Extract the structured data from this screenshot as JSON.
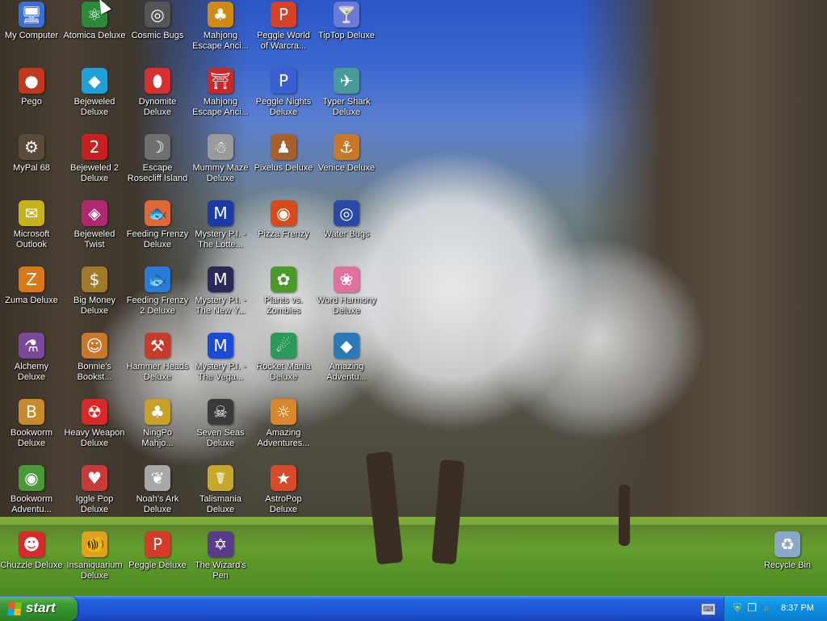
{
  "desktop": {
    "icons": [
      {
        "label": "My Computer",
        "icon": "computer-icon",
        "symbol": "🖥",
        "color": "#3b6fd6"
      },
      {
        "label": "Atomica Deluxe",
        "icon": "atomica-icon",
        "symbol": "⚛",
        "color": "#2a8a3a"
      },
      {
        "label": "Cosmic Bugs",
        "icon": "cosmic-bugs-icon",
        "symbol": "◎",
        "color": "#555555"
      },
      {
        "label": "Mahjong\nEscape Anci...",
        "icon": "mahjong-escape-icon",
        "symbol": "♣",
        "color": "#d18a10"
      },
      {
        "label": "Peggle World\nof Warcra...",
        "icon": "peggle-world-icon",
        "symbol": "P",
        "color": "#d8402a"
      },
      {
        "label": "TipTop Deluxe",
        "icon": "tiptop-icon",
        "symbol": "🍸",
        "color": "#6a7ad8"
      },
      {
        "label": "Pego",
        "icon": "pego-icon",
        "symbol": "●",
        "color": "#c0391f"
      },
      {
        "label": "Bejeweled\nDeluxe",
        "icon": "bejeweled-icon",
        "symbol": "◆",
        "color": "#20a0d8"
      },
      {
        "label": "Dynomite\nDeluxe",
        "icon": "dynomite-icon",
        "symbol": "⬮",
        "color": "#d83030"
      },
      {
        "label": "Mahjong\nEscape Anci...",
        "icon": "mahjong-escape-2-icon",
        "symbol": "⛩",
        "color": "#c82828"
      },
      {
        "label": "Peggle Nights\nDeluxe",
        "icon": "peggle-nights-icon",
        "symbol": "P",
        "color": "#3a5fd0"
      },
      {
        "label": "Typer Shark\nDeluxe",
        "icon": "typer-shark-icon",
        "symbol": "✈",
        "color": "#4a9a9a"
      },
      {
        "label": "MyPal 68",
        "icon": "mypal-icon",
        "symbol": "⚙",
        "color": "#5a4a3a"
      },
      {
        "label": "Bejeweled 2\nDeluxe",
        "icon": "bejeweled-2-icon",
        "symbol": "2",
        "color": "#c82020"
      },
      {
        "label": "Escape\nRosecliff Island",
        "icon": "escape-rosecliff-icon",
        "symbol": "☽",
        "color": "#707070"
      },
      {
        "label": "Mummy Maze\nDeluxe",
        "icon": "mummy-maze-icon",
        "symbol": "☃",
        "color": "#9a9a9a"
      },
      {
        "label": "Pixelus Deluxe",
        "icon": "pixelus-icon",
        "symbol": "♟",
        "color": "#a8602a"
      },
      {
        "label": "Venice Deluxe",
        "icon": "venice-icon",
        "symbol": "⚓",
        "color": "#c8782a"
      },
      {
        "label": "Microsoft\nOutlook",
        "icon": "outlook-icon",
        "symbol": "✉",
        "color": "#c8b21a"
      },
      {
        "label": "Bejeweled\nTwist",
        "icon": "bejeweled-twist-icon",
        "symbol": "◈",
        "color": "#b02870"
      },
      {
        "label": "Feeding Frenzy\nDeluxe",
        "icon": "feeding-frenzy-icon",
        "symbol": "🐟",
        "color": "#e06838"
      },
      {
        "label": "Mystery P.I. -\nThe Lotte...",
        "icon": "mystery-pi-lottery-icon",
        "symbol": "M",
        "color": "#1a3aa8"
      },
      {
        "label": "Pizza Frenzy",
        "icon": "pizza-frenzy-icon",
        "symbol": "◉",
        "color": "#d84a1a"
      },
      {
        "label": "Water Bugs",
        "icon": "water-bugs-icon",
        "symbol": "◎",
        "color": "#2a48a8"
      },
      {
        "label": "Zuma Deluxe",
        "icon": "zuma-icon",
        "symbol": "Z",
        "color": "#d87818"
      },
      {
        "label": "Big Money\nDeluxe",
        "icon": "big-money-icon",
        "symbol": "$",
        "color": "#a07a2a"
      },
      {
        "label": "Feeding Frenzy\n2 Deluxe",
        "icon": "feeding-frenzy-2-icon",
        "symbol": "🐟",
        "color": "#2a7ad8"
      },
      {
        "label": "Mystery P.I. -\nThe New Y...",
        "icon": "mystery-pi-new-york-icon",
        "symbol": "M",
        "color": "#2a2a5a"
      },
      {
        "label": "Plants vs.\nZombies",
        "icon": "plants-vs-zombies-icon",
        "symbol": "✿",
        "color": "#4a9a2a"
      },
      {
        "label": "Word Harmony\nDeluxe",
        "icon": "word-harmony-icon",
        "symbol": "❀",
        "color": "#e070a0"
      },
      {
        "label": "Alchemy\nDeluxe",
        "icon": "alchemy-icon",
        "symbol": "⚗",
        "color": "#7a4a9a"
      },
      {
        "label": "Bonnie's\nBookst...",
        "icon": "bonnies-bookstore-icon",
        "symbol": "☺",
        "color": "#c8782a"
      },
      {
        "label": "Hammer Heads\nDeluxe",
        "icon": "hammer-heads-icon",
        "symbol": "⚒",
        "color": "#c83a2a"
      },
      {
        "label": "Mystery P.I. -\nThe Vega...",
        "icon": "mystery-pi-vegas-icon",
        "symbol": "M",
        "color": "#1a4ad8"
      },
      {
        "label": "Rocket Mania\nDeluxe",
        "icon": "rocket-mania-icon",
        "symbol": "☄",
        "color": "#2a9a5a"
      },
      {
        "label": "Amazing\nAdventu...",
        "icon": "amazing-adventures-icon",
        "symbol": "◆",
        "color": "#2a7ab8"
      },
      {
        "label": "Bookworm\nDeluxe",
        "icon": "bookworm-icon",
        "symbol": "B",
        "color": "#c88a2a"
      },
      {
        "label": "Heavy Weapon\nDeluxe",
        "icon": "heavy-weapon-icon",
        "symbol": "☢",
        "color": "#d82828"
      },
      {
        "label": "NingPo\nMahjo...",
        "icon": "ningpo-mahjong-icon",
        "symbol": "♣",
        "color": "#c8a02a"
      },
      {
        "label": "Seven Seas\nDeluxe",
        "icon": "seven-seas-icon",
        "symbol": "☠",
        "color": "#3a3a3a"
      },
      {
        "label": "Amazing\nAdventures...",
        "icon": "amazing-adventures-2-icon",
        "symbol": "☼",
        "color": "#d8882a"
      },
      {
        "label": "Bookworm\nAdventu...",
        "icon": "bookworm-adventures-icon",
        "symbol": "◉",
        "color": "#4a9a3a"
      },
      {
        "label": "Iggle Pop\nDeluxe",
        "icon": "iggle-pop-icon",
        "symbol": "♥",
        "color": "#c83a3a"
      },
      {
        "label": "Noah's Ark\nDeluxe",
        "icon": "noahs-ark-icon",
        "symbol": "❦",
        "color": "#a8a8a8"
      },
      {
        "label": "Talismania\nDeluxe",
        "icon": "talismania-icon",
        "symbol": "☤",
        "color": "#c8a82a"
      },
      {
        "label": "AstroPop\nDeluxe",
        "icon": "astropop-icon",
        "symbol": "★",
        "color": "#d84a2a"
      },
      {
        "label": "Chuzzle Deluxe",
        "icon": "chuzzle-icon",
        "symbol": "☻",
        "color": "#d82a2a"
      },
      {
        "label": "Insaniquarium\nDeluxe",
        "icon": "insaniquarium-icon",
        "symbol": "🐠",
        "color": "#e0a020"
      },
      {
        "label": "Peggle Deluxe",
        "icon": "peggle-icon",
        "symbol": "P",
        "color": "#d83a2a"
      },
      {
        "label": "The Wizard's\nPen",
        "icon": "wizards-pen-icon",
        "symbol": "✡",
        "color": "#5a3a8a"
      }
    ],
    "recycle_bin": {
      "label": "Recycle Bin",
      "icon": "recycle-bin-icon",
      "symbol": "♻",
      "color": "#8aa8c8"
    }
  },
  "taskbar": {
    "start_label": "start",
    "clock": "8:37 PM",
    "tray_icons": [
      {
        "icon": "security-shield-icon",
        "symbol": "⛨",
        "color": "#f0d020"
      },
      {
        "icon": "network-icon",
        "symbol": "❐",
        "color": "#ffffff"
      },
      {
        "icon": "search-icon",
        "symbol": "⌕",
        "color": "#ff8a2a"
      }
    ],
    "quick_icon": {
      "icon": "keyboard-icon",
      "symbol": "⌨"
    }
  }
}
